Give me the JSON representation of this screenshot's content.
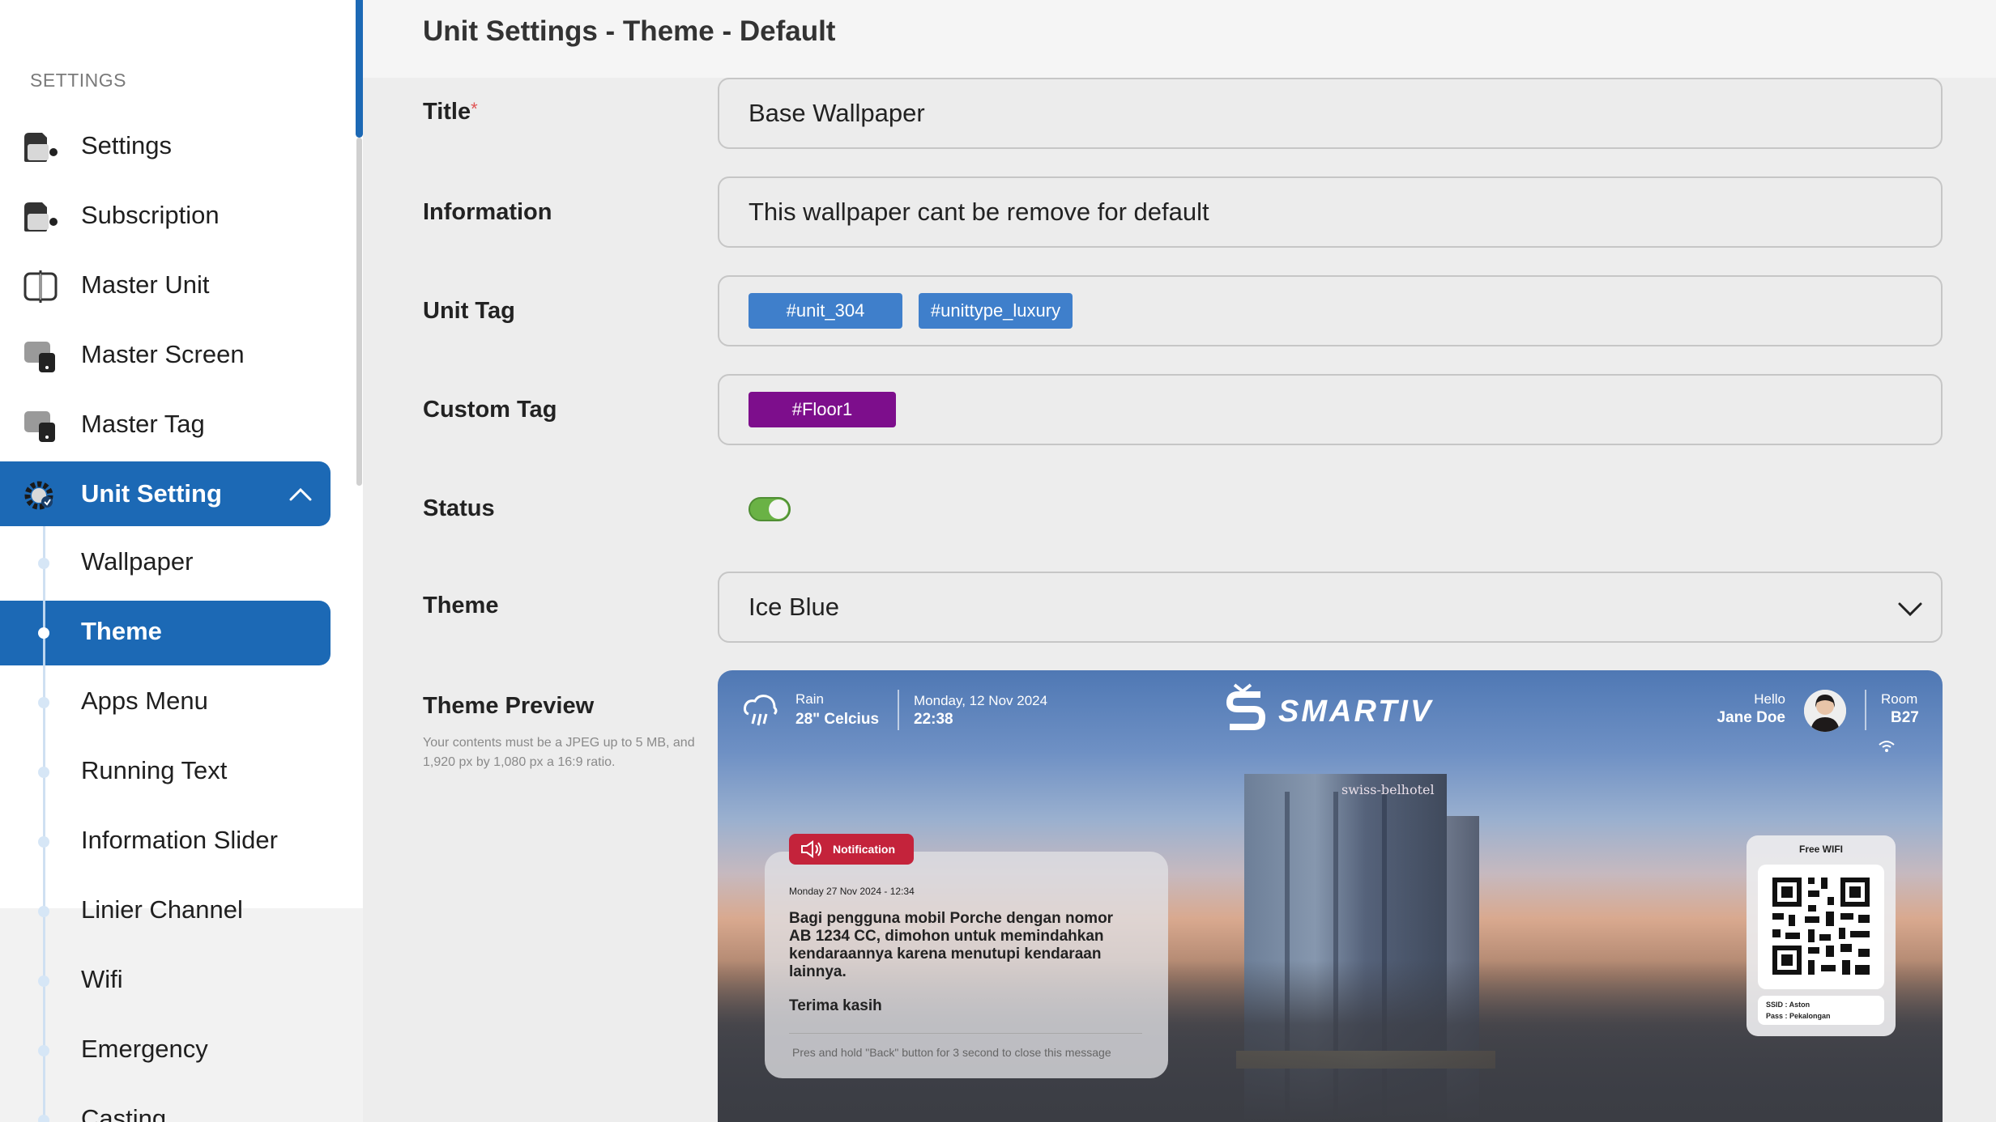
{
  "sidebar": {
    "section_label": "SETTINGS",
    "items": [
      {
        "label": "Settings"
      },
      {
        "label": "Subscription"
      },
      {
        "label": "Master Unit"
      },
      {
        "label": "Master Screen"
      },
      {
        "label": "Master Tag"
      },
      {
        "label": "Unit Setting"
      }
    ],
    "sub_items": [
      {
        "label": "Wallpaper"
      },
      {
        "label": "Theme"
      },
      {
        "label": "Apps Menu"
      },
      {
        "label": "Running Text"
      },
      {
        "label": "Information Slider"
      },
      {
        "label": "Linier Channel"
      },
      {
        "label": "Wifi"
      },
      {
        "label": "Emergency"
      },
      {
        "label": "Casting"
      }
    ],
    "active_sub_item": "Theme",
    "accent": "#1c69b5"
  },
  "header": {
    "title": "Unit Settings - Theme - Default"
  },
  "form": {
    "title_label": "Title",
    "required_mark": "*",
    "title_value": "Base Wallpaper",
    "information_label": "Information",
    "information_value": "This wallpaper cant be remove for default",
    "unit_tag_label": "Unit Tag",
    "unit_tags": [
      "#unit_304",
      "#unittype_luxury"
    ],
    "unit_tag_color": "#3f7fcb",
    "custom_tag_label": "Custom Tag",
    "custom_tags": [
      "#Floor1"
    ],
    "custom_tag_color": "#7d0e8c",
    "status_label": "Status",
    "status_on": true,
    "theme_label": "Theme",
    "theme_value": "Ice Blue",
    "preview_label": "Theme Preview",
    "preview_hint": "Your contents must be a JPEG up to 5 MB, and 1,920 px by 1,080 px a 16:9 ratio."
  },
  "preview": {
    "weather": "Rain",
    "temperature": "28ʺ Celcius",
    "date": "Monday, 12 Nov 2024",
    "time": "22:38",
    "brand": "SMARTIV",
    "greeting": "Hello",
    "guest_name": "Jane Doe",
    "room_label": "Room",
    "room_number": "B27",
    "hotel_sign": "swiss-belhotel",
    "notification": {
      "badge": "Notification",
      "datetime": "Monday 27 Nov 2024 - 12:34",
      "message": "Bagi pengguna mobil Porche dengan nomor AB 1234 CC, dimohon untuk memindahkan kendaraannya karena menutupi kendaraan lainnya.",
      "thanks": "Terima kasih",
      "footer": "Pres and hold \"Back\" button for 3 second to close this message"
    },
    "wifi": {
      "title": "Free WIFI",
      "ssid": "SSID : Aston",
      "pass": "Pass : Pekalongan"
    }
  }
}
